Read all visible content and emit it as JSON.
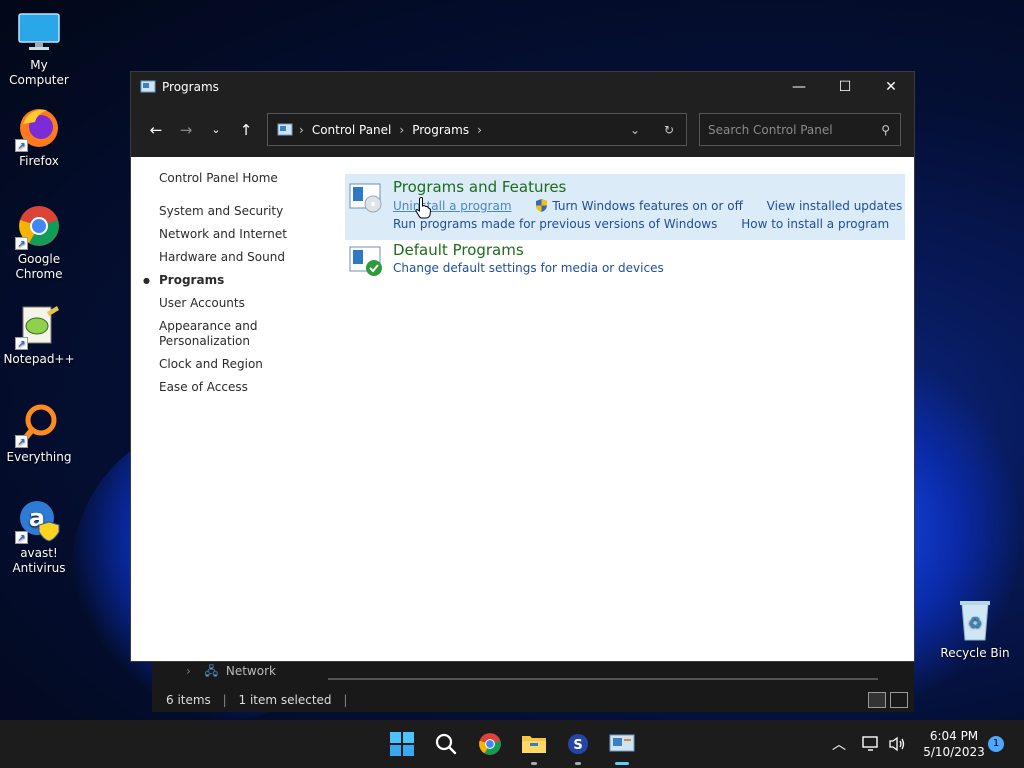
{
  "desktop": {
    "icons": [
      {
        "label": "My Computer"
      },
      {
        "label": "Firefox"
      },
      {
        "label": "Google Chrome"
      },
      {
        "label": "Notepad++"
      },
      {
        "label": "Everything"
      },
      {
        "label": "avast! Antivirus"
      },
      {
        "label": "Recycle Bin"
      }
    ]
  },
  "background_window": {
    "nav_item": "Network",
    "status_items": "6 items",
    "status_selected": "1 item selected"
  },
  "window": {
    "title": "Programs",
    "breadcrumb": [
      "Control Panel",
      "Programs"
    ],
    "search_placeholder": "Search Control Panel",
    "left_nav": {
      "home": "Control Panel Home",
      "items": [
        "System and Security",
        "Network and Internet",
        "Hardware and Sound",
        "Programs",
        "User Accounts",
        "Appearance and Personalization",
        "Clock and Region",
        "Ease of Access"
      ],
      "active_index": 3
    },
    "categories": {
      "programs_features": {
        "title": "Programs and Features",
        "links_row1": [
          "Uninstall a program",
          "Turn Windows features on or off",
          "View installed updates"
        ],
        "links_row2": [
          "Run programs made for previous versions of Windows",
          "How to install a program"
        ]
      },
      "default_programs": {
        "title": "Default Programs",
        "link": "Change default settings for media or devices"
      }
    }
  },
  "taskbar": {
    "time": "6:04 PM",
    "date": "5/10/2023",
    "notification_count": "1"
  },
  "colors": {
    "titlebar": "#202020",
    "category_hover": "#dbebf7",
    "category_title": "#1e6a1e",
    "link": "#1f4e9a",
    "accent": "#60cdff"
  }
}
